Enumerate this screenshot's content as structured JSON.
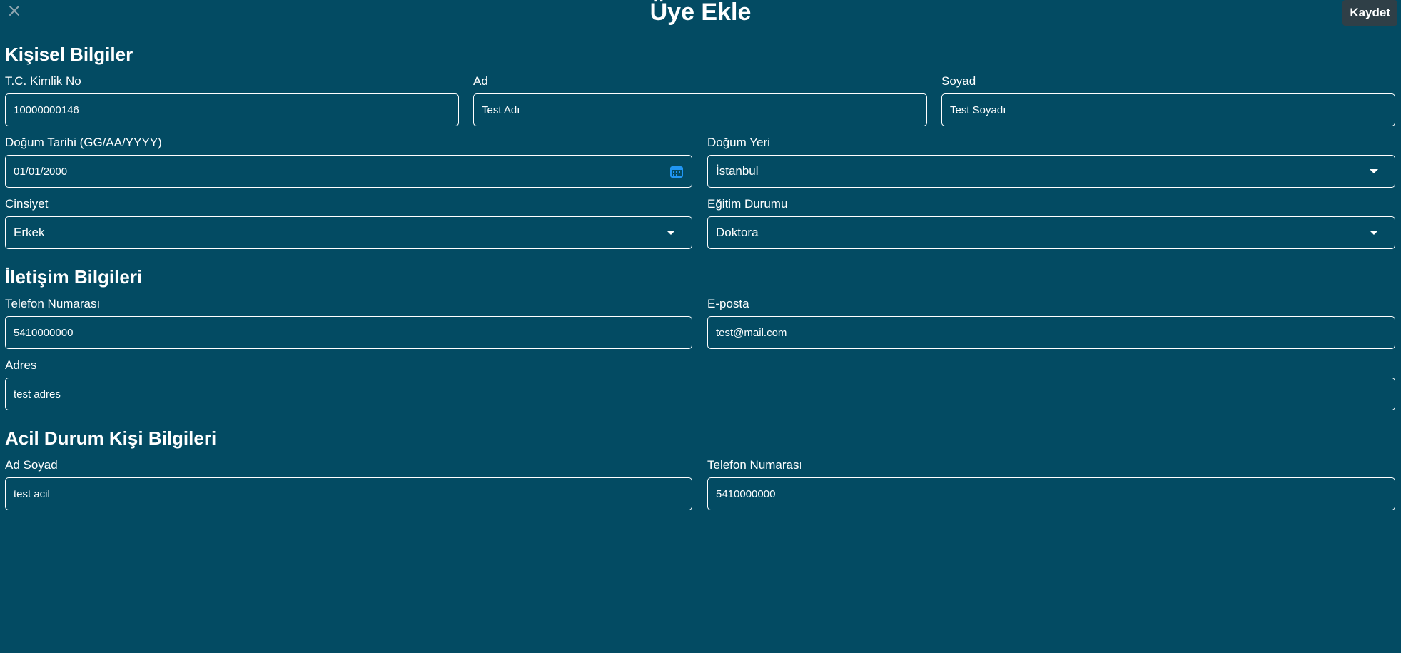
{
  "header": {
    "title": "Üye Ekle",
    "save_label": "Kaydet",
    "close_icon": "close-icon"
  },
  "sections": {
    "personal": "Kişisel Bilgiler",
    "contact": "İletişim Bilgileri",
    "emergency": "Acil Durum Kişi Bilgileri"
  },
  "personal": {
    "tc": {
      "label": "T.C. Kimlik No",
      "value": "10000000146"
    },
    "first_name": {
      "label": "Ad",
      "value": "Test Adı"
    },
    "last_name": {
      "label": "Soyad",
      "value": "Test Soyadı"
    },
    "birth_date": {
      "label": "Doğum Tarihi  (GG/AA/YYYY)",
      "value": "01/01/2000",
      "icon": "calendar-icon"
    },
    "birth_place": {
      "label": "Doğum Yeri",
      "value": "İstanbul"
    },
    "gender": {
      "label": "Cinsiyet",
      "value": "Erkek"
    },
    "education": {
      "label": "Eğitim Durumu",
      "value": "Doktora"
    }
  },
  "contact": {
    "phone": {
      "label": "Telefon Numarası",
      "value": "5410000000"
    },
    "email": {
      "label": "E-posta",
      "value": "test@mail.com"
    },
    "address": {
      "label": "Adres",
      "value": "test adres"
    }
  },
  "emergency": {
    "name": {
      "label": "Ad Soyad",
      "value": "test acil"
    },
    "phone": {
      "label": "Telefon Numarası",
      "value": "5410000000"
    }
  },
  "colors": {
    "background": "#034b63",
    "accent": "#2196f3",
    "save_button": "#2f3f47"
  }
}
